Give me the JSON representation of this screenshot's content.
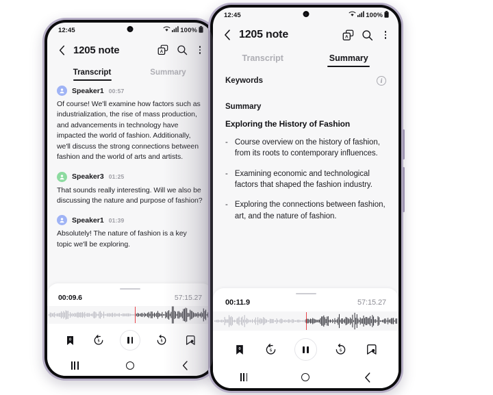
{
  "colors": {
    "frame_outer": "#b6aec6",
    "frame_bezel": "#0c0c0e",
    "screen_bg": "#f7f7f8",
    "accent_playhead": "#e8434a",
    "avatar_blue": "#9fb3f5",
    "avatar_green": "#8ddba0",
    "text_primary": "#16161a",
    "text_muted": "#9b9ba2"
  },
  "left_phone": {
    "status": {
      "time": "12:45",
      "battery": "100%",
      "wifi_icon": "wifi-icon",
      "signal_icon": "signal-icon",
      "battery_icon": "battery-icon"
    },
    "header": {
      "back_icon": "back-chevron-icon",
      "title": "1205 note",
      "translate_icon": "translate-icon",
      "search_icon": "search-icon",
      "more_icon": "more-options-icon"
    },
    "tabs": [
      {
        "label": "Transcript",
        "active": true
      },
      {
        "label": "Summary",
        "active": false
      }
    ],
    "transcript": [
      {
        "speaker": "Speaker1",
        "time": "00:57",
        "avatar": "person-icon",
        "avatar_color": "#9fb3f5",
        "text": "Of course! We'll examine how factors such as industrialization, the rise of mass production, and advancements in technology have impacted the world of fashion. Additionally, we'll discuss the strong connections between fashion and the world of arts and artists."
      },
      {
        "speaker": "Speaker3",
        "time": "01:25",
        "avatar": "person-icon",
        "avatar_color": "#8ddba0",
        "text": "That sounds really interesting. Will we also be discussing the nature and purpose of fashion?"
      },
      {
        "speaker": "Speaker1",
        "time": "01:39",
        "avatar": "person-icon",
        "avatar_color": "#9fb3f5",
        "text": "Absolutely! The nature of fashion is a key topic we'll be exploring."
      }
    ],
    "player": {
      "current_time": "00:09.6",
      "total_time": "57:15.27",
      "progress_percent": 53,
      "controls": [
        {
          "name": "bookmark-add-icon",
          "label": "bookmark"
        },
        {
          "name": "rewind-5-icon",
          "label": "rewind 5 seconds"
        },
        {
          "name": "pause-icon",
          "label": "pause"
        },
        {
          "name": "forward-5-icon",
          "label": "forward 5 seconds"
        },
        {
          "name": "note-bookmark-icon",
          "label": "note"
        }
      ]
    },
    "navbar": [
      {
        "name": "nav-recents-icon"
      },
      {
        "name": "nav-home-icon"
      },
      {
        "name": "nav-back-icon"
      }
    ]
  },
  "right_phone": {
    "status": {
      "time": "12:45",
      "battery": "100%",
      "wifi_icon": "wifi-icon",
      "signal_icon": "signal-icon",
      "battery_icon": "battery-icon"
    },
    "header": {
      "back_icon": "back-chevron-icon",
      "title": "1205 note",
      "translate_icon": "translate-icon",
      "search_icon": "search-icon",
      "more_icon": "more-options-icon"
    },
    "tabs": [
      {
        "label": "Transcript",
        "active": false
      },
      {
        "label": "Summary",
        "active": true
      }
    ],
    "summary": {
      "keywords_label": "Keywords",
      "info_icon": "info-icon",
      "summary_label": "Summary",
      "summary_title": "Exploring the History of Fashion",
      "bullet_marker": "-",
      "bullets": [
        "Course overview on the history of fashion, from its roots to contemporary influences.",
        "Examining economic and technological factors that shaped the fashion industry.",
        "Exploring the connections between fashion, art, and the nature of fashion."
      ]
    },
    "player": {
      "current_time": "00:11.9",
      "total_time": "57:15.27",
      "progress_percent": 50,
      "controls": [
        {
          "name": "bookmark-add-icon",
          "label": "bookmark"
        },
        {
          "name": "rewind-5-icon",
          "label": "rewind 5 seconds"
        },
        {
          "name": "pause-icon",
          "label": "pause"
        },
        {
          "name": "forward-5-icon",
          "label": "forward 5 seconds"
        },
        {
          "name": "note-bookmark-icon",
          "label": "note"
        }
      ]
    },
    "navbar": [
      {
        "name": "nav-recents-icon"
      },
      {
        "name": "nav-home-icon"
      },
      {
        "name": "nav-back-icon"
      }
    ]
  }
}
